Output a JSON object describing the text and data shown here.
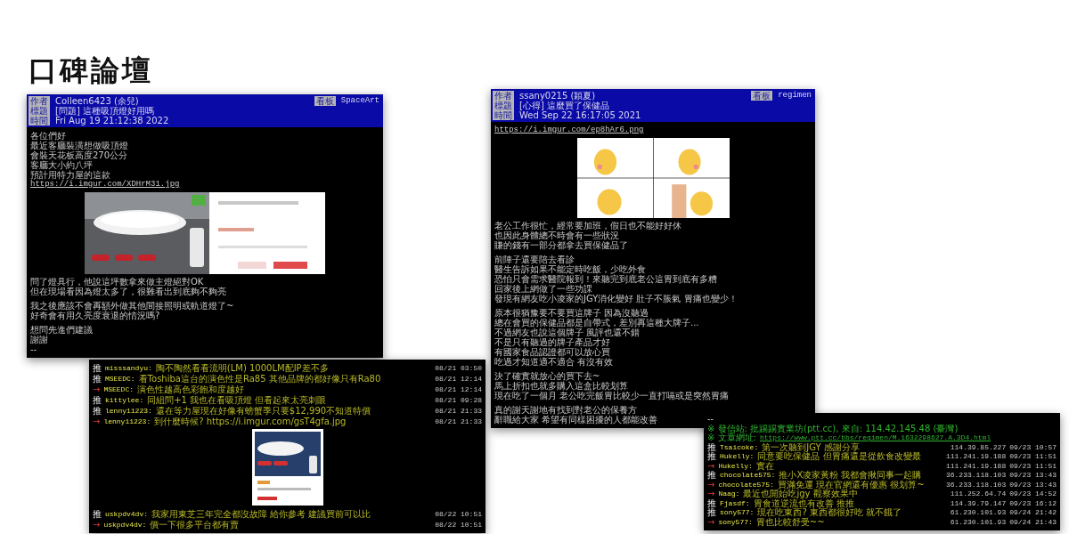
{
  "page_title": "口碑論壇",
  "left_post": {
    "header": {
      "labels": [
        "作者",
        "標題",
        "時間"
      ],
      "author": "Colleen6423 (余兒)",
      "subject": "[問題] 這種吸頂燈好用嗎",
      "time": "Fri Aug 19 21:12:38 2022",
      "board_label": "看板",
      "board": "SpaceArt"
    },
    "lines": [
      {
        "kind": "text",
        "text": "各位們好"
      },
      {
        "kind": "text",
        "text": "最近客廳裝潢想做吸頂燈"
      },
      {
        "kind": "text",
        "text": "會裝天花板高度270公分"
      },
      {
        "kind": "text",
        "text": "客廳大小約八坪"
      },
      {
        "kind": "text",
        "text": "預計用特力屋的這款"
      },
      {
        "kind": "link",
        "text": "https://i.imgur.com/XDHrM31.jpg"
      },
      {
        "kind": "picture"
      },
      {
        "kind": "text",
        "text": "問了燈具行，他說這坪數拿來做主燈絕對OK"
      },
      {
        "kind": "text",
        "text": "但在現場看因為燈太多了，很難看出到底夠不夠亮"
      },
      {
        "kind": "blank"
      },
      {
        "kind": "text",
        "text": "我之後應該不會再額外做其他間接照明或軌道燈了~"
      },
      {
        "kind": "text",
        "text": "好奇會有用久亮度衰退的情況嗎?"
      },
      {
        "kind": "blank"
      },
      {
        "kind": "text",
        "text": "想問先進們建議"
      },
      {
        "kind": "text",
        "text": "謝謝"
      },
      {
        "kind": "text",
        "text": "--"
      }
    ]
  },
  "left_comments": [
    {
      "kind": "push",
      "tag": "推",
      "user": "misssandyu:",
      "text": "陶不陶然看看流明(LM) 1000LM配IP差不多",
      "time": "08/21 03:50"
    },
    {
      "kind": "push",
      "tag": "推",
      "user": "MSEEDC:",
      "text": "看Toshiba這台的演色性是Ra85 其他品牌的都好像只有Ra80",
      "time": "08/21 12:14"
    },
    {
      "kind": "arrow",
      "tag": "→",
      "user": "MSEEDC:",
      "text": "演色性越高色彩飽和度越好",
      "time": "08/21 12:14"
    },
    {
      "kind": "push",
      "tag": "推",
      "user": "kittylee:",
      "text": "同組問+1 我也在看吸頂燈 但看起來太亮刺眼",
      "time": "08/21 09:28"
    },
    {
      "kind": "push",
      "tag": "推",
      "user": "lenny11223:",
      "text": "還在等力屋現在好像有螃蟹季只要$12,990不知道特價",
      "time": "08/21 21:33"
    },
    {
      "kind": "arrow",
      "tag": "→",
      "user": "lenny11223:",
      "text": "到什麼時候? https://i.imgur.com/gsT4gfa.jpg",
      "time": "08/21 21:33"
    },
    {
      "kind": "picture"
    },
    {
      "kind": "push",
      "tag": "推",
      "user": "uskpdv4dv:",
      "text": "我家用東芝三年完全都沒故障 給你參考 建議買前可以比",
      "time": "08/22 10:51"
    },
    {
      "kind": "arrow",
      "tag": "→",
      "user": "uskpdv4dv:",
      "text": "價一下很多平台都有賣",
      "time": "08/22 10:51"
    }
  ],
  "right_post": {
    "header": {
      "labels": [
        "作者",
        "標題",
        "時間"
      ],
      "author": "ssany0215 (穎夏)",
      "subject": "[心得] 這麼買了保健品",
      "time": "Wed Sep 22 16:17:05 2021",
      "board_label": "看板",
      "board": "regimen"
    },
    "lines": [
      {
        "kind": "link",
        "text": "https://i.imgur.com/ep8hAr6.png"
      },
      {
        "kind": "picture"
      },
      {
        "kind": "text",
        "text": "老公工作很忙，經常要加班，假日也不能好好休"
      },
      {
        "kind": "text",
        "text": "也因此身體總不時會有一些狀況"
      },
      {
        "kind": "text",
        "text": "賺的錢有一部分都拿去買保健品了"
      },
      {
        "kind": "blank"
      },
      {
        "kind": "text",
        "text": "前陣子還要陪去看診"
      },
      {
        "kind": "text",
        "text": "醫生告訴如果不能定時吃飯，少吃外食"
      },
      {
        "kind": "text",
        "text": "恐怕只會需求醫院報到！來聽完到底老公這胃到底有多糟"
      },
      {
        "kind": "text",
        "text": "回家後上網做了一些功課"
      },
      {
        "kind": "text",
        "text": "發現有網友吃小凌家的JGY消化變好 肚子不脹氣 胃痛也變少！"
      },
      {
        "kind": "blank"
      },
      {
        "kind": "text",
        "text": "原本很猶豫要不要買這牌子 因為沒聽過"
      },
      {
        "kind": "text",
        "text": "總在會買的保健品都是自帶式，差別再這種大牌子..."
      },
      {
        "kind": "text",
        "text": "不過網友也說這個牌子 風評也還不錯"
      },
      {
        "kind": "text",
        "text": "不是只有聽過的牌子產品才好"
      },
      {
        "kind": "text",
        "text": "有國家食品認證都可以放心買"
      },
      {
        "kind": "text",
        "text": "吃過才知道適不適合 有沒有效"
      },
      {
        "kind": "blank"
      },
      {
        "kind": "text",
        "text": "決了確實就放心的買下去~"
      },
      {
        "kind": "text",
        "text": "馬上折扣也就多購入這盒比較划算"
      },
      {
        "kind": "text",
        "text": "現在吃了一個月 老公吃完飯胃比較少一直打嗝或是突然胃痛"
      },
      {
        "kind": "blank"
      },
      {
        "kind": "text",
        "text": "真的謝天謝地有找到對老公的保養方"
      },
      {
        "kind": "text",
        "text": "辭職給大家 希望有同樣困擾的人都能改善"
      }
    ]
  },
  "right_comments": {
    "lines": [
      {
        "kind": "text",
        "text": "--"
      },
      {
        "kind": "note",
        "mark": "※",
        "text": "發信站: 批踢踢實業坊(ptt.cc), 來自: 114.42.145.48 (臺灣)"
      },
      {
        "kind": "note_link",
        "mark": "※",
        "text": "文章網址:",
        "link": "https://www.ptt.cc/bbs/regimen/M.1632298627.A.3D4.html"
      }
    ],
    "comments": [
      {
        "kind": "push",
        "tag": "推",
        "user": "Tsaicoke:",
        "text": "第一次聽到JGY 感謝分享",
        "ip": "114.39.85.227",
        "time": "09/23 10:57"
      },
      {
        "kind": "push",
        "tag": "推",
        "user": "Hukelly:",
        "text": "同意要吃保健品 但胃痛還是從飲食改變最",
        "ip": "111.241.19.188",
        "time": "09/23 11:51"
      },
      {
        "kind": "arrow",
        "tag": "→",
        "user": "Hukelly:",
        "text": "實在",
        "ip": "111.241.19.188",
        "time": "09/23 11:51"
      },
      {
        "kind": "push",
        "tag": "推",
        "user": "chocolate575:",
        "text": "推小X凌家黃粉 我都會揪同事一起購",
        "ip": "36.233.118.103",
        "time": "09/23 13:43"
      },
      {
        "kind": "arrow",
        "tag": "→",
        "user": "chocolate575:",
        "text": "買滿免運 現在官網還有優惠 很划算~",
        "ip": "36.233.118.103",
        "time": "09/23 13:43"
      },
      {
        "kind": "arrow",
        "tag": "→",
        "user": "Naag:",
        "text": "最近也開始吃jgy 觀察效果中",
        "ip": "111.252.64.74",
        "time": "09/23 14:52"
      },
      {
        "kind": "push",
        "tag": "推",
        "user": "Fjasdf:",
        "text": "胃食道逆流也有改善 推推",
        "ip": "114.39.79.147",
        "time": "09/23 16:12"
      },
      {
        "kind": "push",
        "tag": "推",
        "user": "sony577:",
        "text": "現在吃東西? 東西都很好吃 就不餓了",
        "ip": "61.230.101.93",
        "time": "09/24 21:42"
      },
      {
        "kind": "arrow",
        "tag": "→",
        "user": "sony577:",
        "text": "胃也比較舒受~~",
        "ip": "61.230.101.93",
        "time": "09/24 21:43"
      }
    ]
  }
}
